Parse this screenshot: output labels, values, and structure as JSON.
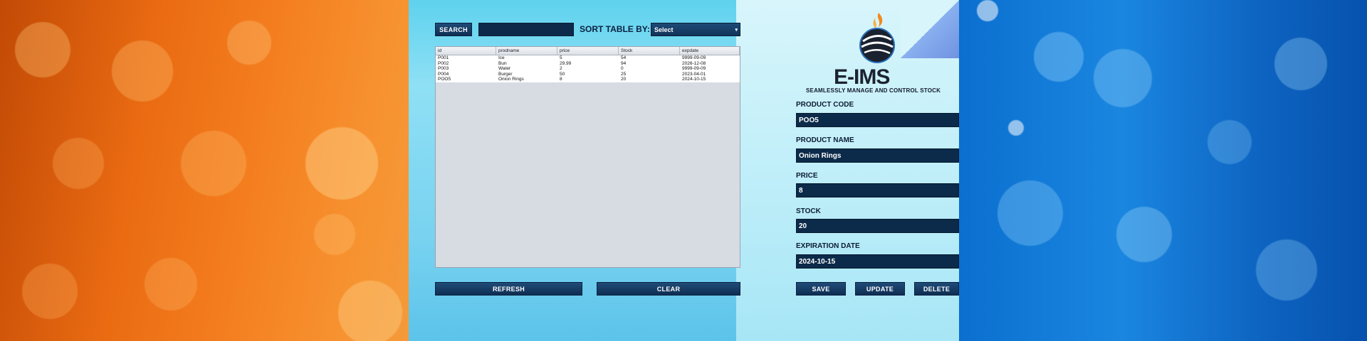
{
  "app": {
    "name": "E-IMS",
    "tagline": "SEAMLESSLY MANAGE AND CONTROL STOCK"
  },
  "search": {
    "button_label": "SEARCH",
    "value": ""
  },
  "sort": {
    "label": "SORT TABLE BY:",
    "selected": "Select"
  },
  "table": {
    "columns": [
      "id",
      "prodname",
      "price",
      "Stock",
      "expdate"
    ],
    "rows": [
      [
        "P001",
        "Ice",
        "5",
        "54",
        "9999-09-09"
      ],
      [
        "P002",
        "Bun",
        "29.99",
        "94",
        "2026-12-08"
      ],
      [
        "P003",
        "Water",
        "2",
        "0",
        "9999-09-09"
      ],
      [
        "P004",
        "Burger",
        "50",
        "25",
        "2023-04-01"
      ],
      [
        "POO5",
        "Onion Rings",
        "8",
        "20",
        "2024-10-15"
      ]
    ]
  },
  "buttons": {
    "refresh": "REFRESH",
    "clear": "CLEAR",
    "save": "SAVE",
    "update": "UPDATE",
    "delete": "DELETE"
  },
  "form": {
    "product_code": {
      "label": "PRODUCT CODE",
      "value": "POO5"
    },
    "product_name": {
      "label": "PRODUCT NAME",
      "value": "Onion Rings"
    },
    "price": {
      "label": "PRICE",
      "value": "8"
    },
    "stock": {
      "label": "STOCK",
      "value": "20"
    },
    "expiration_date": {
      "label": "EXPIRATION DATE",
      "value": "2024-10-15"
    }
  },
  "colors": {
    "accent": "#0c2a49",
    "panel": "#78d2f0"
  }
}
